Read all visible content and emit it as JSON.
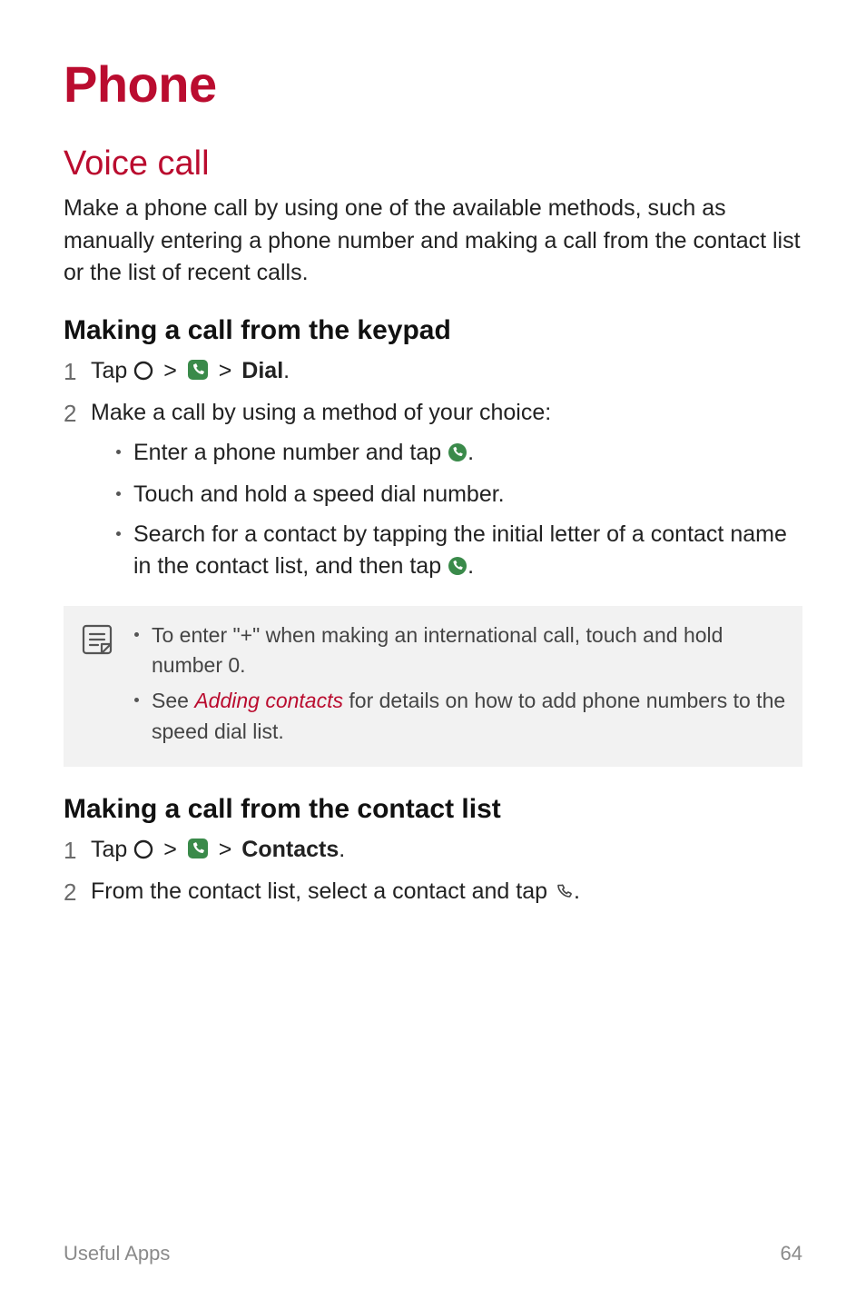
{
  "h1": "Phone",
  "voice_call": {
    "heading": "Voice call",
    "intro": "Make a phone call by using one of the available methods, such as manually entering a phone number and making a call from the contact list or the list of recent calls."
  },
  "keypad": {
    "heading": "Making a call from the keypad",
    "step1": {
      "num": "1",
      "prefix": "Tap ",
      "dial_label": "Dial",
      "suffix": "."
    },
    "step2": {
      "num": "2",
      "text": "Make a call by using a method of your choice:",
      "bullets": {
        "b1_pre": "Enter a phone number and tap ",
        "b1_post": ".",
        "b2": "Touch and hold a speed dial number.",
        "b3_pre": "Search for a contact by tapping the initial letter of a contact name in the contact list, and then tap ",
        "b3_post": "."
      }
    },
    "note": {
      "n1": "To enter \"+\" when making an international call, touch and hold number 0.",
      "n2_pre": "See ",
      "n2_link": "Adding contacts",
      "n2_post": " for details on how to add phone numbers to the speed dial list."
    }
  },
  "contact_list": {
    "heading": "Making a call from the contact list",
    "step1": {
      "num": "1",
      "prefix": "Tap ",
      "contacts_label": "Contacts",
      "suffix": "."
    },
    "step2": {
      "num": "2",
      "pre": "From the contact list, select a contact and tap ",
      "post": "."
    }
  },
  "footer": {
    "section": "Useful Apps",
    "page": "64"
  },
  "sep": ">"
}
